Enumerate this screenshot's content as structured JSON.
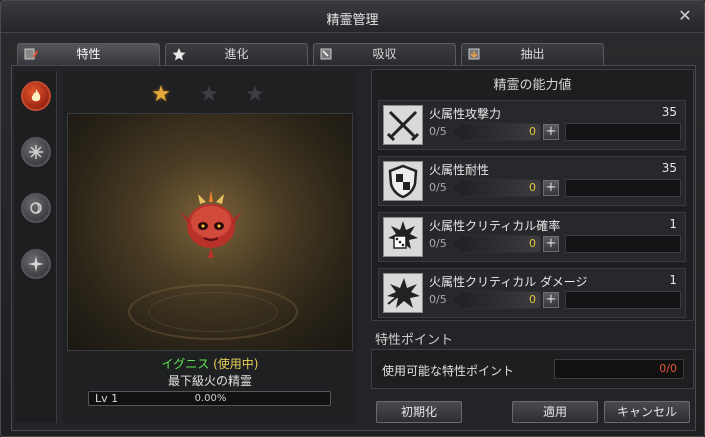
{
  "window": {
    "title": "精霊管理"
  },
  "tabs": [
    {
      "label": "特性",
      "active": true
    },
    {
      "label": "進化",
      "active": false
    },
    {
      "label": "吸収",
      "active": false
    },
    {
      "label": "抽出",
      "active": false
    }
  ],
  "elements": [
    {
      "name": "fire",
      "selected": true
    },
    {
      "name": "ice",
      "selected": false
    },
    {
      "name": "wind",
      "selected": false
    },
    {
      "name": "light",
      "selected": false
    }
  ],
  "spirit": {
    "stars_filled": 1,
    "stars_total": 3,
    "name": "イグニス",
    "status": "(使用中)",
    "subtitle": "最下級火の精霊",
    "level_label": "Lv 1",
    "exp_percent": "0.00%",
    "exp_fraction": 0.0
  },
  "stats": {
    "heading": "精霊の能力値",
    "rows": [
      {
        "name": "火属性攻撃力",
        "value": "35",
        "count": "0/5",
        "points": "0",
        "icon": "crossed-swords-icon"
      },
      {
        "name": "火属性耐性",
        "value": "35",
        "count": "0/5",
        "points": "0",
        "icon": "shield-icon"
      },
      {
        "name": "火属性クリティカル確率",
        "value": "1",
        "count": "0/5",
        "points": "0",
        "icon": "dice-icon"
      },
      {
        "name": "火属性クリティカル ダメージ",
        "value": "1",
        "count": "0/5",
        "points": "0",
        "icon": "burst-icon"
      }
    ]
  },
  "points": {
    "heading": "特性ポイント",
    "label": "使用可能な特性ポイント",
    "value": "0/0"
  },
  "buttons": {
    "reset": "初期化",
    "apply": "適用",
    "cancel": "キャンセル"
  },
  "colors": {
    "name_green": "#5ee64f",
    "status_yellow": "#e7d25a",
    "points_red": "#e4533b",
    "star_gold": "#e4a93a"
  }
}
